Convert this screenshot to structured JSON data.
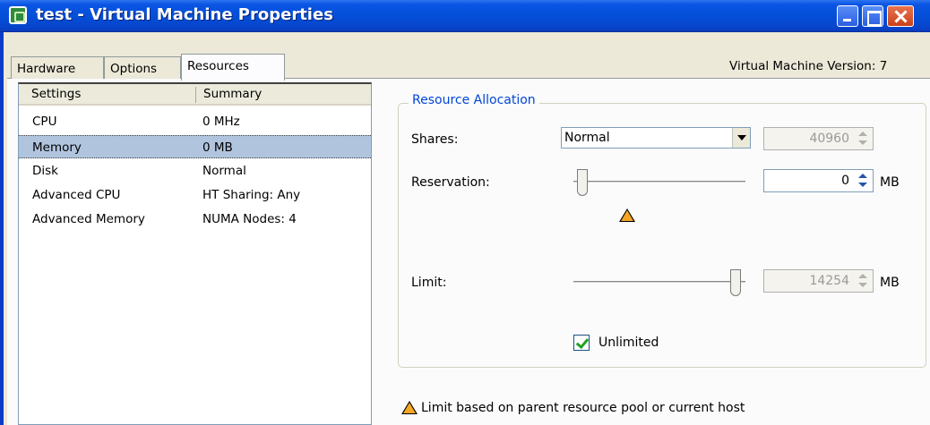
{
  "window": {
    "title": "test - Virtual Machine Properties"
  },
  "tabs": [
    {
      "label": "Hardware"
    },
    {
      "label": "Options"
    },
    {
      "label": "Resources",
      "selected": true
    }
  ],
  "vm_version": "Virtual Machine Version: 7",
  "settings_list": {
    "columns": [
      "Settings",
      "Summary"
    ],
    "rows": [
      {
        "setting": "CPU",
        "summary": "0 MHz"
      },
      {
        "setting": "Memory",
        "summary": "0 MB",
        "selected": true
      },
      {
        "setting": "Disk",
        "summary": "Normal"
      },
      {
        "setting": "Advanced CPU",
        "summary": "HT Sharing: Any"
      },
      {
        "setting": "Advanced Memory",
        "summary": "NUMA Nodes: 4"
      }
    ]
  },
  "resource_allocation": {
    "legend": "Resource Allocation",
    "shares": {
      "label": "Shares:",
      "value": "Normal",
      "number": "40960"
    },
    "reservation": {
      "label": "Reservation:",
      "value": "0",
      "unit": "MB",
      "slider_fraction": 0.0
    },
    "limit": {
      "label": "Limit:",
      "value": "14254",
      "unit": "MB",
      "slider_fraction": 1.0
    },
    "unlimited": {
      "label": "Unlimited",
      "checked": true
    }
  },
  "footnote": "Limit based on parent resource pool or current host",
  "icons": {
    "app": "vm-icon",
    "warning": "warning-triangle-icon"
  },
  "colors": {
    "titlebar": "#0450d8",
    "legend": "#0046d5",
    "selection": "#b0c4de",
    "warning": "#f5a623"
  }
}
